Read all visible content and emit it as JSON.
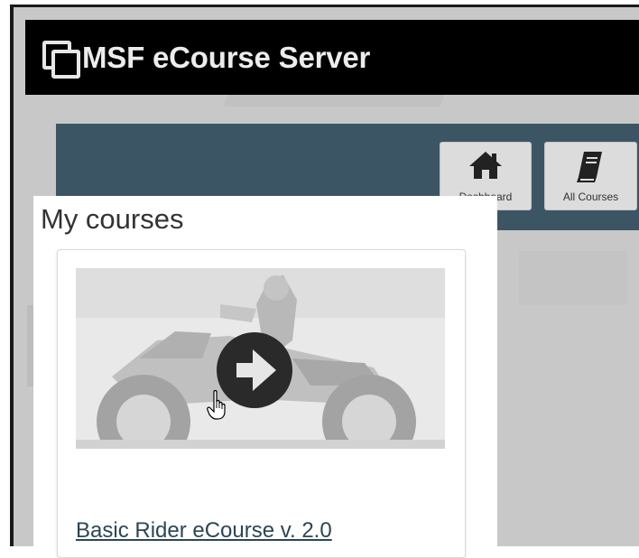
{
  "app": {
    "title": "MSF eCourse Server",
    "brand_icon": "copy-squares-icon"
  },
  "nav": {
    "buttons": [
      {
        "label": "Dashboard",
        "icon": "home-icon"
      },
      {
        "label": "All Courses",
        "icon": "book-icon"
      }
    ]
  },
  "panel": {
    "title": "My courses"
  },
  "courses": [
    {
      "title": "Basic Rider eCourse v. 2.0",
      "image": "motorcycle-rider-photo",
      "action_icon": "arrow-right-circle-icon"
    }
  ],
  "colors": {
    "topbar": "#000000",
    "navband": "#3c5565",
    "link": "#2b4656",
    "page_bg": "#c8c8c8"
  }
}
